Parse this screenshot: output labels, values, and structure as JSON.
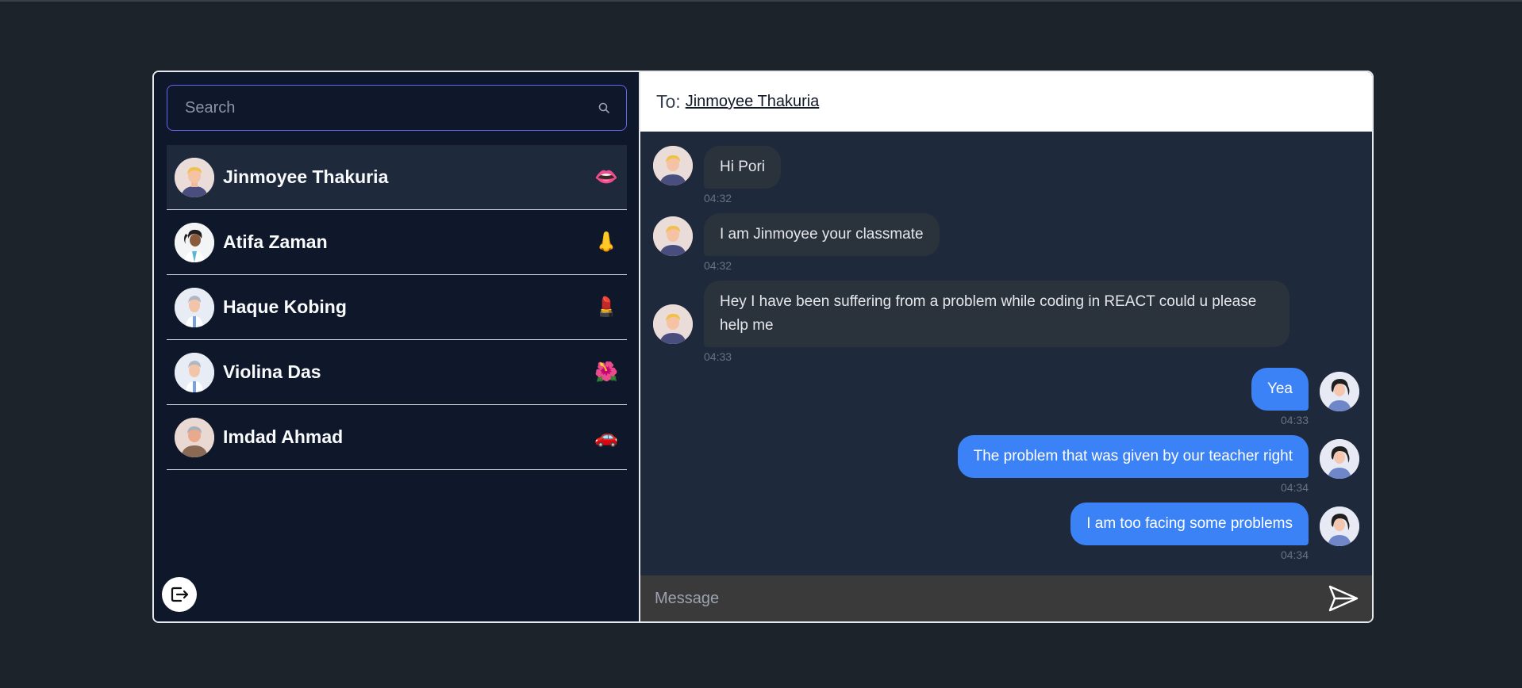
{
  "search": {
    "placeholder": "Search"
  },
  "contacts": [
    {
      "name": "Jinmoyee Thakuria",
      "emoji": "👄",
      "active": true
    },
    {
      "name": "Atifa Zaman",
      "emoji": "👃",
      "active": false
    },
    {
      "name": "Haque Kobing",
      "emoji": "💄",
      "active": false
    },
    {
      "name": "Violina Das",
      "emoji": "🌺",
      "active": false
    },
    {
      "name": "Imdad Ahmad",
      "emoji": "🚗",
      "active": false
    }
  ],
  "header": {
    "to_label": "To:",
    "recipient": "Jinmoyee Thakuria"
  },
  "messages": [
    {
      "direction": "in",
      "text": "Hi Pori",
      "time": "04:32"
    },
    {
      "direction": "in",
      "text": "I am Jinmoyee your classmate",
      "time": "04:32"
    },
    {
      "direction": "in",
      "text": "Hey I have been suffering from a problem while coding in REACT could u please help me",
      "time": "04:33"
    },
    {
      "direction": "out",
      "text": "Yea",
      "time": "04:33"
    },
    {
      "direction": "out",
      "text": "The problem that was given by our teacher right",
      "time": "04:34"
    },
    {
      "direction": "out",
      "text": "I am too facing some problems",
      "time": "04:34"
    }
  ],
  "composer": {
    "placeholder": "Message"
  },
  "icons": {
    "search": "search-icon",
    "logout": "logout-icon",
    "send": "send-icon"
  },
  "colors": {
    "accent": "#3b82f6",
    "search_border": "#6366f1",
    "sidebar_bg": "#0f172a",
    "chat_bg": "#1e293b"
  }
}
